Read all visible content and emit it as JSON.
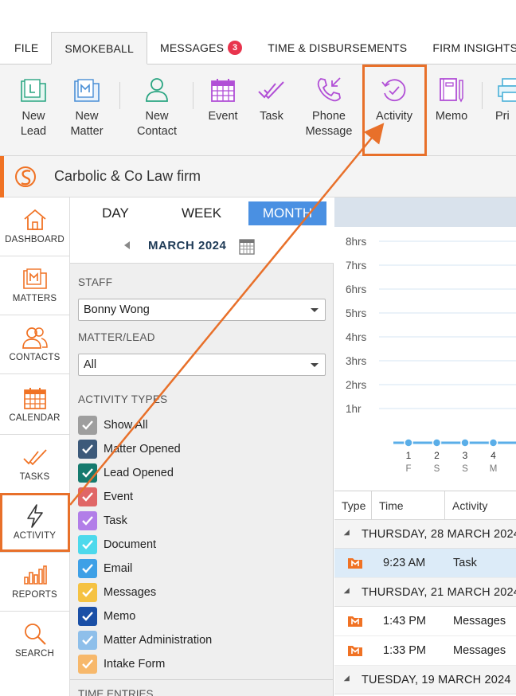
{
  "tabs": [
    {
      "label": "FILE"
    },
    {
      "label": "SMOKEBALL",
      "active": true
    },
    {
      "label": "MESSAGES",
      "badge": "3"
    },
    {
      "label": "TIME & DISBURSEMENTS"
    },
    {
      "label": "FIRM INSIGHTS"
    }
  ],
  "ribbon": {
    "new_lead": "New\nLead",
    "new_matter": "New\nMatter",
    "new_contact": "New\nContact",
    "event": "Event",
    "task": "Task",
    "phone_message": "Phone\nMessage",
    "activity": "Activity",
    "memo": "Memo",
    "print": "Pri"
  },
  "firm": {
    "name": "Carbolic & Co Law firm"
  },
  "nav": {
    "dashboard": "DASHBOARD",
    "matters": "MATTERS",
    "contacts": "CONTACTS",
    "calendar": "CALENDAR",
    "tasks": "TASKS",
    "activity": "ACTIVITY",
    "reports": "REPORTS",
    "search": "SEARCH"
  },
  "filter": {
    "views": {
      "day": "DAY",
      "week": "WEEK",
      "month": "MONTH"
    },
    "month_label": "MARCH 2024",
    "staff_label": "STAFF",
    "staff_value": "Bonny Wong",
    "matter_label": "MATTER/LEAD",
    "matter_value": "All",
    "types_label": "ACTIVITY TYPES",
    "types": [
      {
        "label": "Show All",
        "color": "#9e9e9e"
      },
      {
        "label": "Matter Opened",
        "color": "#3d5a7a"
      },
      {
        "label": "Lead Opened",
        "color": "#157a6e"
      },
      {
        "label": "Event",
        "color": "#e06666"
      },
      {
        "label": "Task",
        "color": "#b27ee8"
      },
      {
        "label": "Document",
        "color": "#4dd9ec"
      },
      {
        "label": "Email",
        "color": "#3ea0e6"
      },
      {
        "label": "Messages",
        "color": "#f5c242"
      },
      {
        "label": "Memo",
        "color": "#1a4fa6"
      },
      {
        "label": "Matter Administration",
        "color": "#8ebfea"
      },
      {
        "label": "Intake Form",
        "color": "#f7b86b"
      }
    ],
    "time_entries_label": "TIME ENTRIES"
  },
  "chart_data": {
    "type": "line",
    "ylabels": [
      "8hrs",
      "7hrs",
      "6hrs",
      "5hrs",
      "4hrs",
      "3hrs",
      "2hrs",
      "1hr"
    ],
    "x": [
      "1",
      "2",
      "3",
      "4"
    ],
    "weekdays": [
      "F",
      "S",
      "S",
      "M"
    ],
    "values": [
      0,
      0,
      0,
      0
    ],
    "ylim": [
      0,
      8
    ]
  },
  "table": {
    "columns": [
      "Type",
      "Time",
      "Activity"
    ],
    "groups": [
      {
        "date": "THURSDAY, 28 MARCH 2024",
        "rows": [
          {
            "time": "9:23 AM",
            "activity": "Task",
            "selected": true
          }
        ]
      },
      {
        "date": "THURSDAY, 21 MARCH 2024",
        "rows": [
          {
            "time": "1:43 PM",
            "activity": "Messages"
          },
          {
            "time": "1:33 PM",
            "activity": "Messages"
          }
        ]
      },
      {
        "date": "TUESDAY, 19 MARCH 2024",
        "rows": []
      }
    ]
  }
}
